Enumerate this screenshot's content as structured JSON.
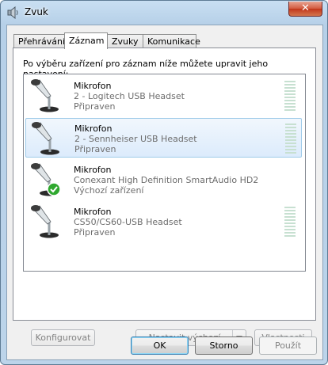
{
  "window": {
    "title": "Zvuk",
    "close_label": "✕"
  },
  "tabs": [
    {
      "label": "Přehrávání"
    },
    {
      "label": "Záznam",
      "active": true
    },
    {
      "label": "Zvuky"
    },
    {
      "label": "Komunikace"
    }
  ],
  "instruction": "Po výběru zařízení pro záznam níže můžete upravit jeho nastavení:",
  "devices": [
    {
      "name": "Mikrofon",
      "desc": "2 - Logitech USB Headset",
      "status": "Připraven",
      "selected": false,
      "default": false
    },
    {
      "name": "Mikrofon",
      "desc": "2 - Sennheiser USB Headset",
      "status": "Připraven",
      "selected": true,
      "default": false
    },
    {
      "name": "Mikrofon",
      "desc": "Conexant High Definition SmartAudio HD2",
      "status": "Výchozí zařízení",
      "selected": false,
      "default": true
    },
    {
      "name": "Mikrofon",
      "desc": "CS50/CS60-USB Headset",
      "status": "Připraven",
      "selected": false,
      "default": false
    }
  ],
  "buttons": {
    "configure": "Konfigurovat",
    "set_default": "Nastavit výchozí",
    "properties": "Vlastnosti",
    "ok": "OK",
    "cancel": "Storno",
    "apply": "Použít"
  },
  "icons": {
    "device": "microphone-icon",
    "default_badge": "green-check-icon",
    "app": "speaker-icon"
  },
  "colors": {
    "selection": "#dcebfc",
    "meter": "#c7e0d1",
    "check": "#2fa82f"
  }
}
